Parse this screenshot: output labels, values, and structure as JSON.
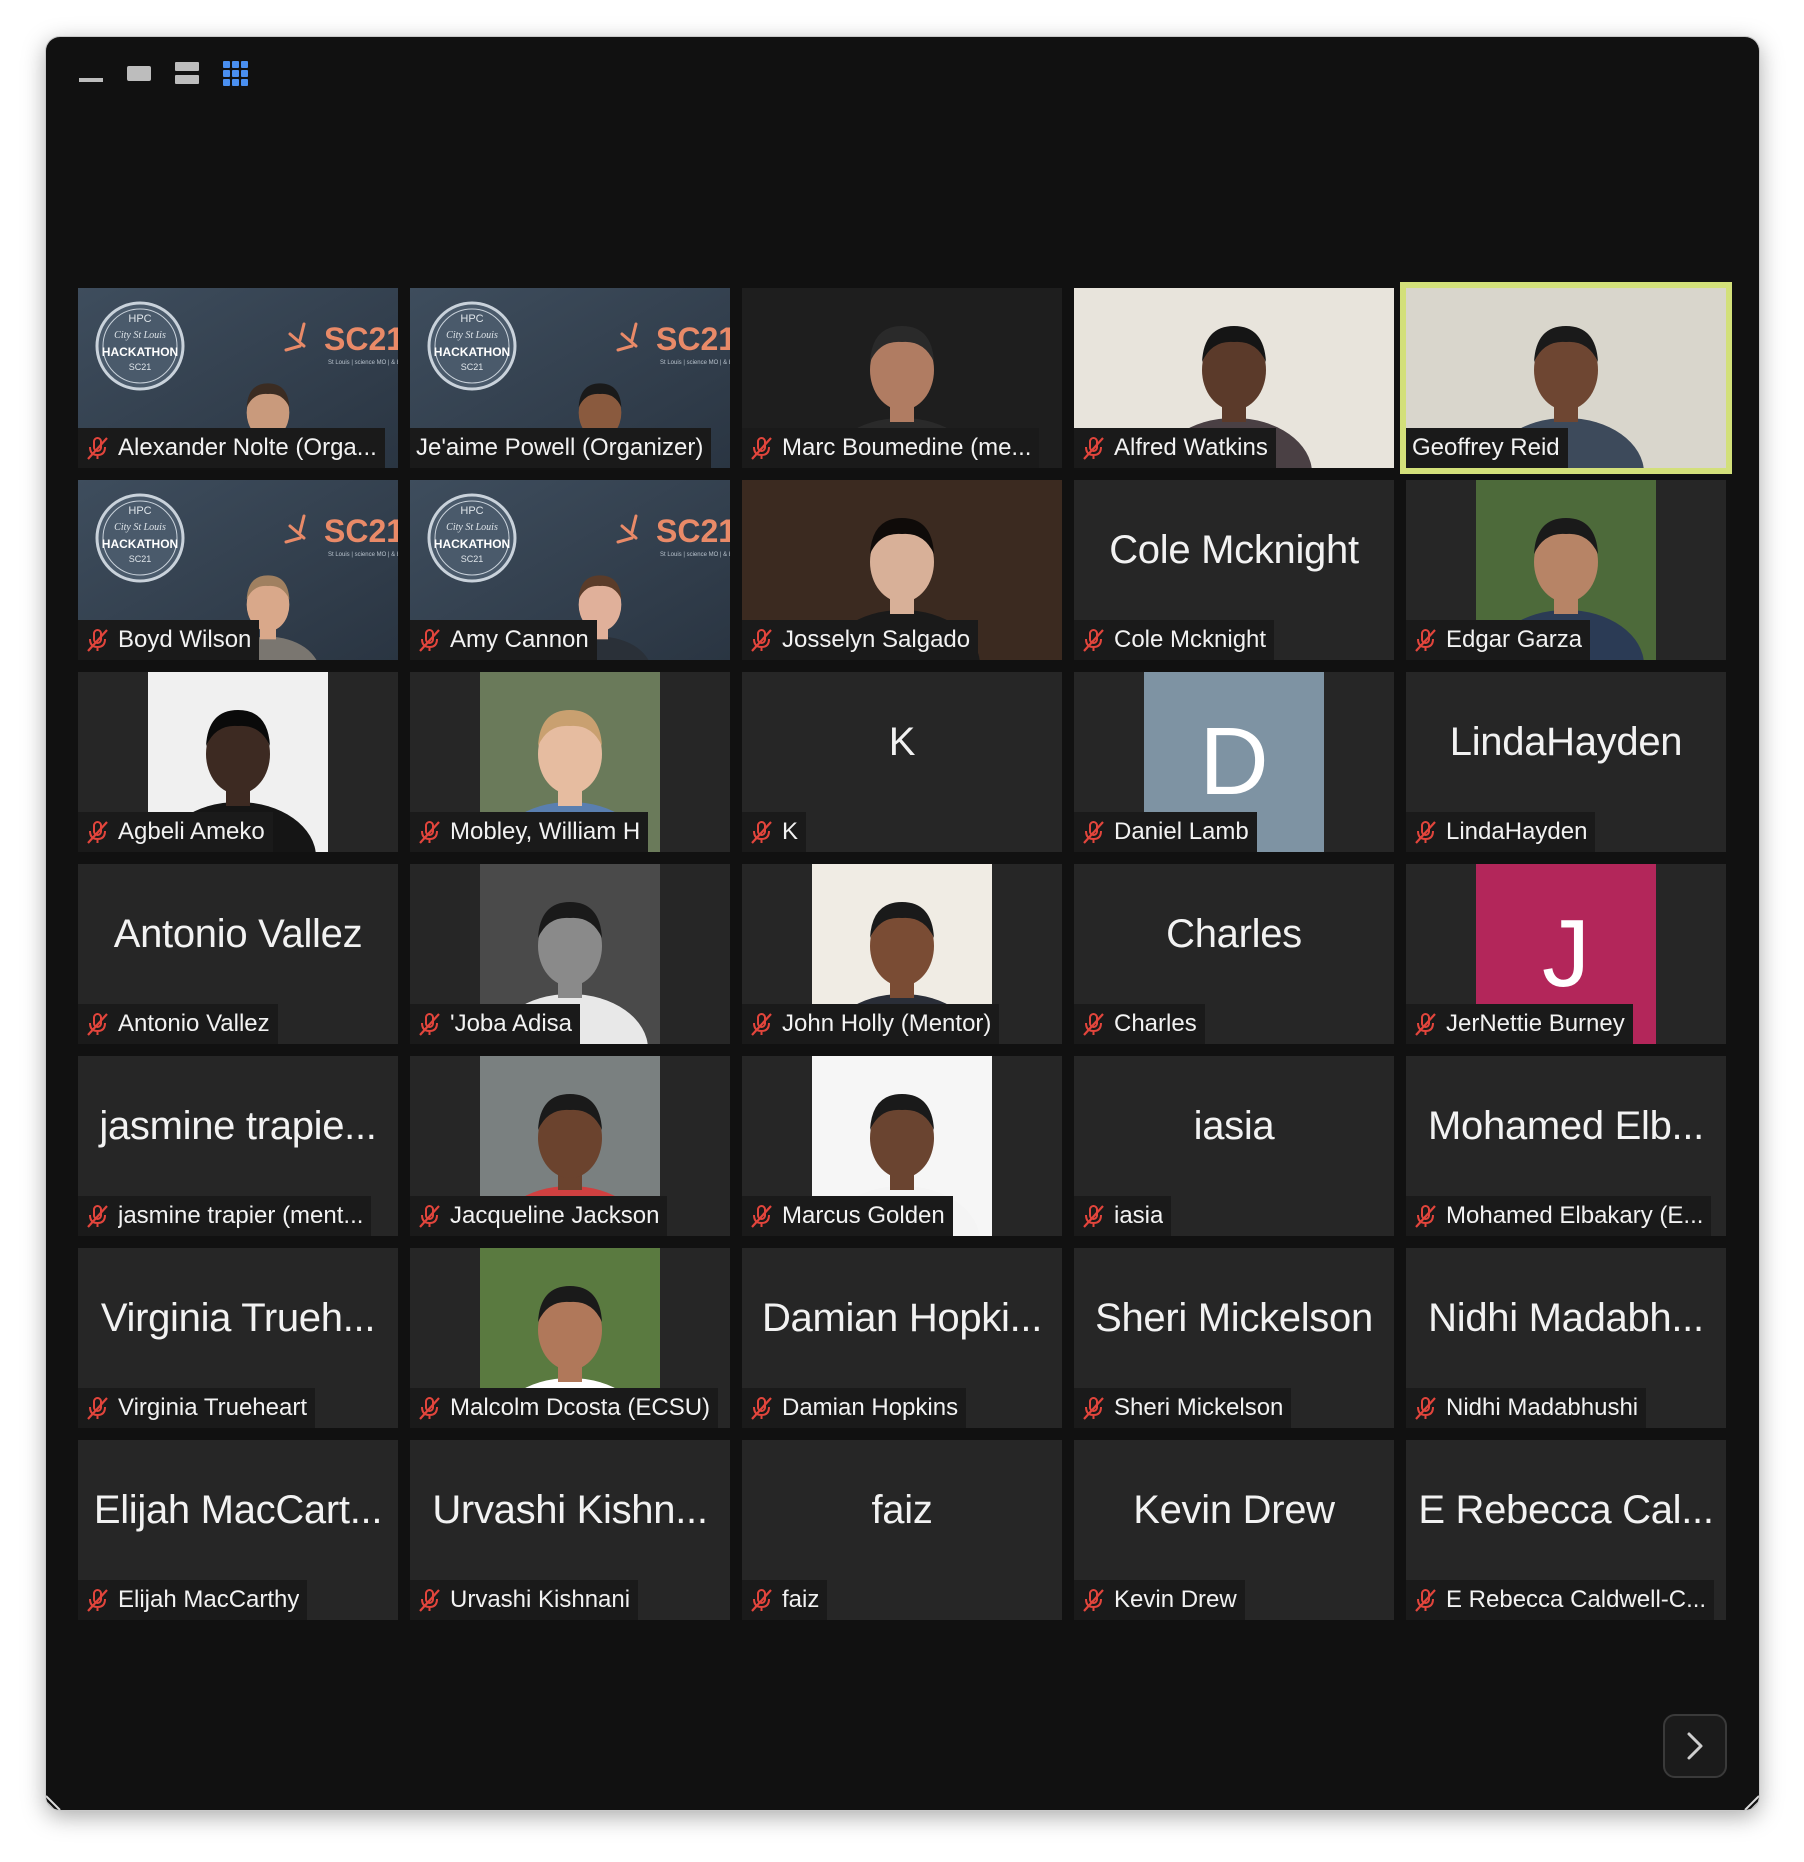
{
  "toolbar": {
    "views": [
      "minimize-view",
      "speaker-view",
      "strip-view",
      "gallery-view"
    ],
    "active_view": "gallery-view",
    "active_color": "#4a8ff0"
  },
  "colors": {
    "window_bg": "#111111",
    "tile_bg": "#262626",
    "active_speaker_outline": "#d3e07a",
    "muted_icon": "#e2453c",
    "avatar_d_bg": "#7e93a3",
    "avatar_j_bg": "#b3265a"
  },
  "participants": [
    {
      "label": "Alexander Nolte (Orga...",
      "kind": "sc21"
    },
    {
      "label": "Je'aime Powell (Organizer)",
      "kind": "sc21",
      "muted": false
    },
    {
      "label": "Marc Boumedine (me...",
      "kind": "video"
    },
    {
      "label": "Alfred Watkins",
      "kind": "video"
    },
    {
      "label": "Geoffrey Reid",
      "kind": "video",
      "muted": false,
      "active": true
    },
    {
      "label": "Boyd Wilson",
      "kind": "sc21"
    },
    {
      "label": "Amy Cannon",
      "kind": "sc21"
    },
    {
      "label": "Josselyn Salgado",
      "kind": "video"
    },
    {
      "label": "Cole Mcknight",
      "card": "Cole Mcknight",
      "kind": "name"
    },
    {
      "label": "Edgar Garza",
      "kind": "photo"
    },
    {
      "label": "Agbeli Ameko",
      "kind": "photo"
    },
    {
      "label": "Mobley, William H",
      "kind": "photo"
    },
    {
      "label": "K",
      "card": "K",
      "kind": "name"
    },
    {
      "label": "Daniel Lamb",
      "letter": "D",
      "kind": "letter"
    },
    {
      "label": "LindaHayden",
      "card": "LindaHayden",
      "kind": "name"
    },
    {
      "label": "Antonio Vallez",
      "card": "Antonio Vallez",
      "kind": "name"
    },
    {
      "label": "'Joba Adisa",
      "kind": "photo"
    },
    {
      "label": "John Holly (Mentor)",
      "kind": "photo"
    },
    {
      "label": "Charles",
      "card": "Charles",
      "kind": "name"
    },
    {
      "label": "JerNettie Burney",
      "letter": "J",
      "kind": "letter"
    },
    {
      "label": "jasmine trapier (ment...",
      "card": "jasmine trapie...",
      "kind": "name"
    },
    {
      "label": "Jacqueline Jackson",
      "kind": "photo"
    },
    {
      "label": "Marcus Golden",
      "kind": "photo"
    },
    {
      "label": "iasia",
      "card": "iasia",
      "kind": "name"
    },
    {
      "label": "Mohamed Elbakary (E...",
      "card": "Mohamed Elb...",
      "kind": "name"
    },
    {
      "label": "Virginia Trueheart",
      "card": "Virginia Trueh...",
      "kind": "name"
    },
    {
      "label": "Malcolm Dcosta (ECSU)",
      "kind": "photo"
    },
    {
      "label": "Damian Hopkins",
      "card": "Damian Hopki...",
      "kind": "name"
    },
    {
      "label": "Sheri Mickelson",
      "card": "Sheri Mickelson",
      "kind": "name"
    },
    {
      "label": "Nidhi Madabhushi",
      "card": "Nidhi Madabh...",
      "kind": "name"
    },
    {
      "label": "Elijah MacCarthy",
      "card": "Elijah MacCart...",
      "kind": "name"
    },
    {
      "label": "Urvashi Kishnani",
      "card": "Urvashi Kishn...",
      "kind": "name"
    },
    {
      "label": "faiz",
      "card": "faiz",
      "kind": "name"
    },
    {
      "label": "Kevin Drew",
      "card": "Kevin Drew",
      "kind": "name"
    },
    {
      "label": "E Rebecca Caldwell-C...",
      "card": "E Rebecca Cal...",
      "kind": "name"
    }
  ],
  "sc21_banner": {
    "badge_top": "HPC",
    "badge_mid": "City St Louis",
    "badge_main": "HACKATHON",
    "badge_bottom": "SC21",
    "logo": "SC21",
    "tagline": "St Louis | science MO | & beyond"
  },
  "pager": {
    "icon": "chevron-right-icon"
  }
}
